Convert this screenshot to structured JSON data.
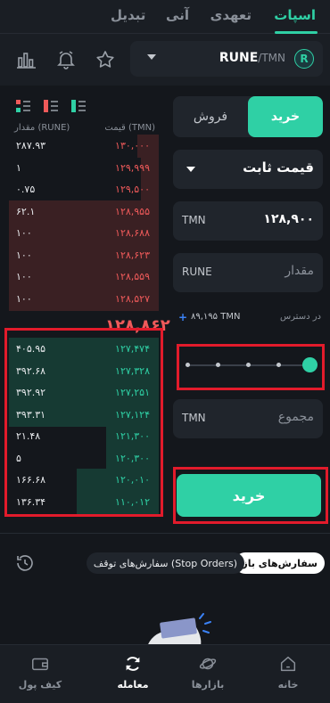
{
  "top_tabs": {
    "spot": "اسپات",
    "margin": "تعهدی",
    "instant": "آنی",
    "convert": "تبدیل"
  },
  "pair": {
    "base": "RUNE",
    "quote": "/TMN",
    "coin_letter": "R"
  },
  "orderbook": {
    "head_price": "قیمت (TMN)",
    "head_amount": "مقدار (RUNE)",
    "sells": [
      {
        "price": "۱۳۰,۰۰۰",
        "amount": "۲۸۷.۹۳",
        "depth": 0.14
      },
      {
        "price": "۱۲۹,۹۹۹",
        "amount": "۱",
        "depth": 0.12
      },
      {
        "price": "۱۲۹,۵۰۰",
        "amount": "۰.۷۵",
        "depth": 0.12
      },
      {
        "price": "۱۲۸,۹۵۵",
        "amount": "۶۲.۱",
        "depth": 1.0
      },
      {
        "price": "۱۲۸,۶۸۸",
        "amount": "۱۰۰",
        "depth": 1.0
      },
      {
        "price": "۱۲۸,۶۲۳",
        "amount": "۱۰۰",
        "depth": 1.0
      },
      {
        "price": "۱۲۸,۵۵۹",
        "amount": "۱۰۰",
        "depth": 1.0
      },
      {
        "price": "۱۲۸,۵۲۷",
        "amount": "۱۰۰",
        "depth": 1.0
      }
    ],
    "last_price": "۱۲۸,۸۶۲",
    "buys": [
      {
        "price": "۱۲۷,۴۷۴",
        "amount": "۴۰۵.۹۵",
        "depth": 1.0
      },
      {
        "price": "۱۲۷,۳۲۸",
        "amount": "۳۹۲.۶۸",
        "depth": 1.0
      },
      {
        "price": "۱۲۷,۲۵۱",
        "amount": "۳۹۲.۹۲",
        "depth": 1.0
      },
      {
        "price": "۱۲۷,۱۲۴",
        "amount": "۳۹۳.۳۱",
        "depth": 1.0
      },
      {
        "price": "۱۲۱,۳۰۰",
        "amount": "۲۱.۴۸",
        "depth": 0.35
      },
      {
        "price": "۱۲۰,۳۰۰",
        "amount": "۵",
        "depth": 0.35
      },
      {
        "price": "۱۲۰,۰۱۰",
        "amount": "۱۶۶.۶۸",
        "depth": 0.55
      },
      {
        "price": "۱۱۰,۰۱۲",
        "amount": "۱۳۶.۳۴",
        "depth": 0.55
      }
    ]
  },
  "form": {
    "buy_label": "خرید",
    "sell_label": "فروش",
    "order_type": "قیمت ثابت",
    "price_unit": "TMN",
    "price_value": "۱۲۸,۹۰۰",
    "amount_unit": "RUNE",
    "amount_placeholder": "مقدار",
    "available_label": "در دسترس",
    "available_value": "۸۹,۱۹۵ TMN",
    "slider_percent": 100,
    "total_unit": "TMN",
    "total_placeholder": "مجموع",
    "submit_label": "خرید"
  },
  "orders_tabs": {
    "open": "سفارش‌های باز",
    "stop": "سفارش‌های توقف (Stop Orders)"
  },
  "bottom_nav": {
    "home": "خانه",
    "markets": "بازارها",
    "trade": "معامله",
    "wallet": "کیف پول"
  },
  "colors": {
    "accent": "#2fd0a5",
    "sell": "#ef5a5a",
    "highlight": "#e21b2b"
  }
}
